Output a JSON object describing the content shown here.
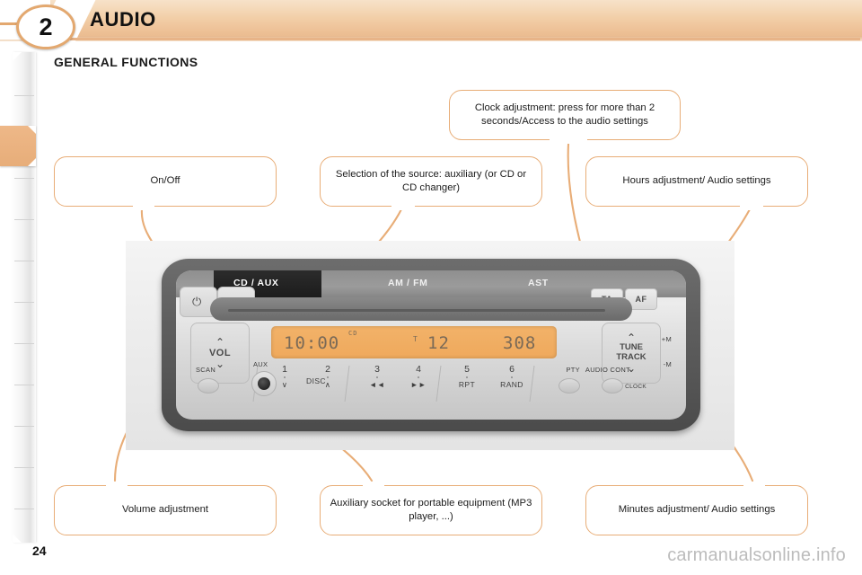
{
  "header": {
    "chapter_number": "2",
    "title": "AUDIO"
  },
  "section": {
    "title": "GENERAL FUNCTIONS"
  },
  "callouts": {
    "clock": "Clock adjustment: press for more than 2 seconds/Access to the audio settings",
    "on_off": "On/Off",
    "source": "Selection of the source: auxiliary (or CD or CD changer)",
    "hours": "Hours adjustment/ Audio settings",
    "volume": "Volume adjustment",
    "aux": "Auxiliary socket for portable equipment (MP3 player, ...)",
    "minutes": "Minutes adjustment/ Audio settings"
  },
  "radio": {
    "band_labels": {
      "cd_aux": "CD / AUX",
      "am_fm": "AM / FM",
      "ast": "AST"
    },
    "ta": "TA",
    "af": "AF",
    "vol": "VOL",
    "tune": "TUNE",
    "track": "TRACK",
    "scan": "SCAN",
    "aux": "AUX",
    "pty": "PTY",
    "audio_cont": "AUDIO CONT",
    "clock": "CLOCK",
    "tune_up_mark": "+M",
    "tune_down_mark": "-M",
    "power_glyph": "⏻",
    "eject_glyph": "⏏",
    "chevron_up": "⌃",
    "chevron_down": "⌄",
    "display": {
      "time": "10:00",
      "mode": "CD",
      "track_prefix": "T",
      "track": "12",
      "frequency": "308"
    },
    "presets": [
      {
        "num": "1",
        "sub": ""
      },
      {
        "num": "2",
        "sub": ""
      },
      {
        "num": "3",
        "sub": "◄◄"
      },
      {
        "num": "4",
        "sub": "►►"
      },
      {
        "num": "5",
        "sub": "RPT"
      },
      {
        "num": "6",
        "sub": "RAND"
      }
    ],
    "disc_label": "DISC",
    "disc_down": "∨",
    "disc_up": "∧"
  },
  "footer": {
    "page_number": "24",
    "watermark": "carmanualsonline.info"
  },
  "colors": {
    "accent": "#e8ad77",
    "header_band": "#f0c79e",
    "lcd": "#f0ab5e"
  }
}
